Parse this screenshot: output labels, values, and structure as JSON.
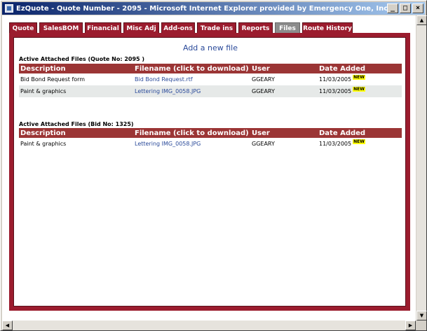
{
  "window": {
    "title": "EzQuote - Quote Number - 2095 - Microsoft Internet Explorer provided by Emergency One, Inc.",
    "buttons": {
      "minimize": "_",
      "maximize": "□",
      "close": "×"
    }
  },
  "tabs": [
    {
      "label": "Quote",
      "active": false
    },
    {
      "label": "SalesBOM",
      "active": false
    },
    {
      "label": "Financial",
      "active": false
    },
    {
      "label": "Misc Adj",
      "active": false
    },
    {
      "label": "Add-ons",
      "active": false
    },
    {
      "label": "Trade ins",
      "active": false
    },
    {
      "label": "Reports",
      "active": false
    },
    {
      "label": "Files",
      "active": true
    },
    {
      "label": "Route History",
      "active": false
    }
  ],
  "add_link": "Add a new file",
  "quote_files": {
    "title": "Active Attached Files (Quote No: 2095 )",
    "columns": [
      "Description",
      "Filename (click to download)",
      "User",
      "Date Added"
    ],
    "rows": [
      {
        "description": "Bid Bond Request form",
        "filename": "Bid Bond Request.rtf",
        "user": "GGEARY",
        "date": "11/03/2005",
        "badge": "NEW"
      },
      {
        "description": "Paint & graphics",
        "filename": "Lettering IMG_0058.JPG",
        "user": "GGEARY",
        "date": "11/03/2005",
        "badge": "NEW"
      }
    ]
  },
  "bid_files": {
    "title": "Active Attached Files (Bid No: 1325)",
    "columns": [
      "Description",
      "Filename (click to download)",
      "User",
      "Date Added"
    ],
    "rows": [
      {
        "description": "Paint & graphics",
        "filename": "Lettering IMG_0058.JPG",
        "user": "GGEARY",
        "date": "11/03/2005",
        "badge": "NEW"
      }
    ]
  },
  "scrollbar": {
    "up": "▲",
    "down": "▼",
    "left": "◀",
    "right": "▶"
  },
  "colors": {
    "accent": "#9b1c2e",
    "header": "#9b3535",
    "link": "#2a4a9a",
    "badge": "#ffff00",
    "active_tab": "#8c8c8c"
  }
}
